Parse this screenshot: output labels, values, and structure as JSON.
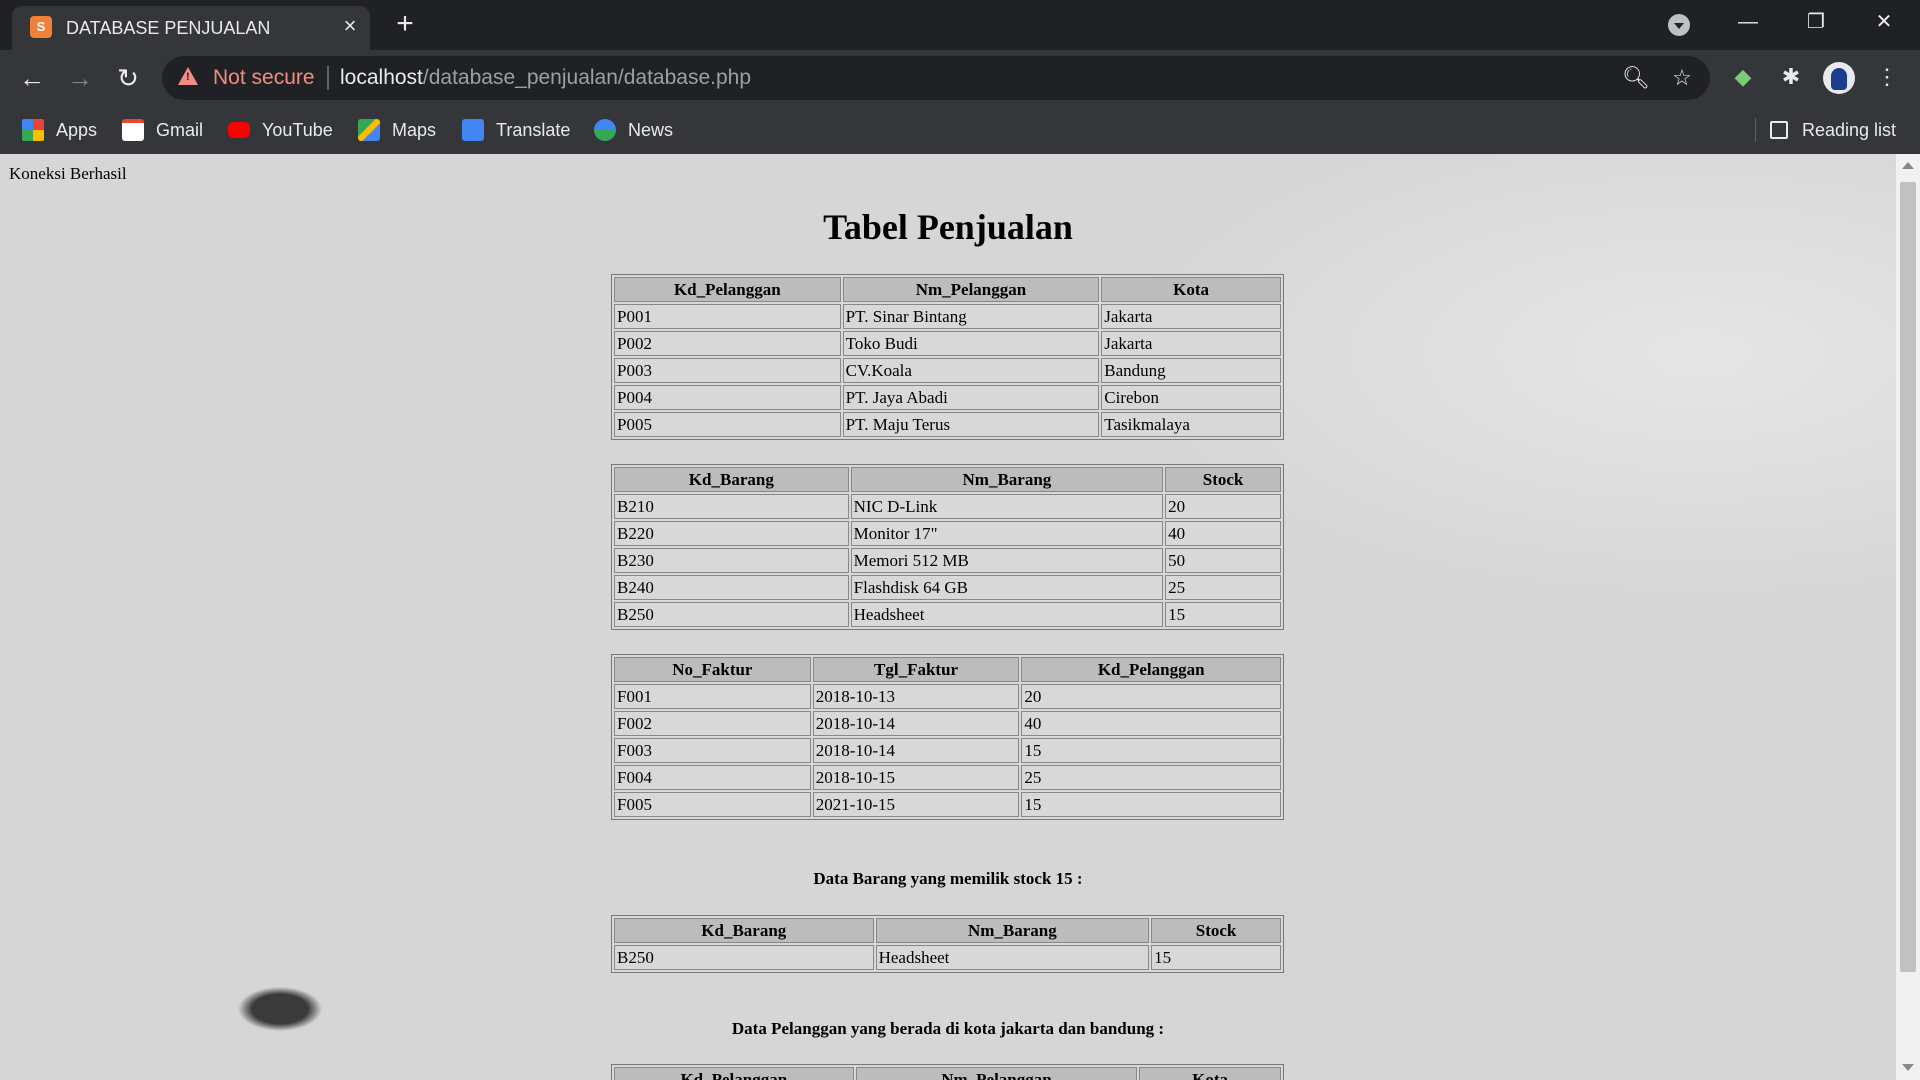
{
  "browser": {
    "tab_title": "DATABASE PENJUALAN",
    "tab_favicon_text": "S",
    "security_label": "Not secure",
    "url_host": "localhost",
    "url_path": "/database_penjualan/database.php",
    "bookmarks": [
      "Apps",
      "Gmail",
      "YouTube",
      "Maps",
      "Translate",
      "News"
    ],
    "reading_list_label": "Reading list"
  },
  "page": {
    "status_text": "Koneksi Berhasil",
    "heading": "Tabel Penjualan",
    "pelanggan_table": {
      "headers": [
        "Kd_Pelanggan",
        "Nm_Pelanggan",
        "Kota"
      ],
      "rows": [
        [
          "P001",
          "PT. Sinar Bintang",
          "Jakarta"
        ],
        [
          "P002",
          "Toko Budi",
          "Jakarta"
        ],
        [
          "P003",
          "CV.Koala",
          "Bandung"
        ],
        [
          "P004",
          "PT. Jaya Abadi",
          "Cirebon"
        ],
        [
          "P005",
          "PT. Maju Terus",
          "Tasikmalaya"
        ]
      ]
    },
    "barang_table": {
      "headers": [
        "Kd_Barang",
        "Nm_Barang",
        "Stock"
      ],
      "rows": [
        [
          "B210",
          "NIC D-Link",
          "20"
        ],
        [
          "B220",
          "Monitor 17\"",
          "40"
        ],
        [
          "B230",
          "Memori 512 MB",
          "50"
        ],
        [
          "B240",
          "Flashdisk 64 GB",
          "25"
        ],
        [
          "B250",
          "Headsheet",
          "15"
        ]
      ]
    },
    "faktur_table": {
      "headers": [
        "No_Faktur",
        "Tgl_Faktur",
        "Kd_Pelanggan"
      ],
      "rows": [
        [
          "F001",
          "2018-10-13",
          "20"
        ],
        [
          "F002",
          "2018-10-14",
          "40"
        ],
        [
          "F003",
          "2018-10-14",
          "15"
        ],
        [
          "F004",
          "2018-10-15",
          "25"
        ],
        [
          "F005",
          "2021-10-15",
          "15"
        ]
      ]
    },
    "stock_caption": "Data Barang yang memilik stock 15 :",
    "stock_table": {
      "headers": [
        "Kd_Barang",
        "Nm_Barang",
        "Stock"
      ],
      "rows": [
        [
          "B250",
          "Headsheet",
          "15"
        ]
      ]
    },
    "kota_caption": "Data Pelanggan yang berada di kota jakarta dan bandung :",
    "kota_table": {
      "headers": [
        "Kd_Pelanggan",
        "Nm_Pelanggan",
        "Kota"
      ]
    }
  }
}
